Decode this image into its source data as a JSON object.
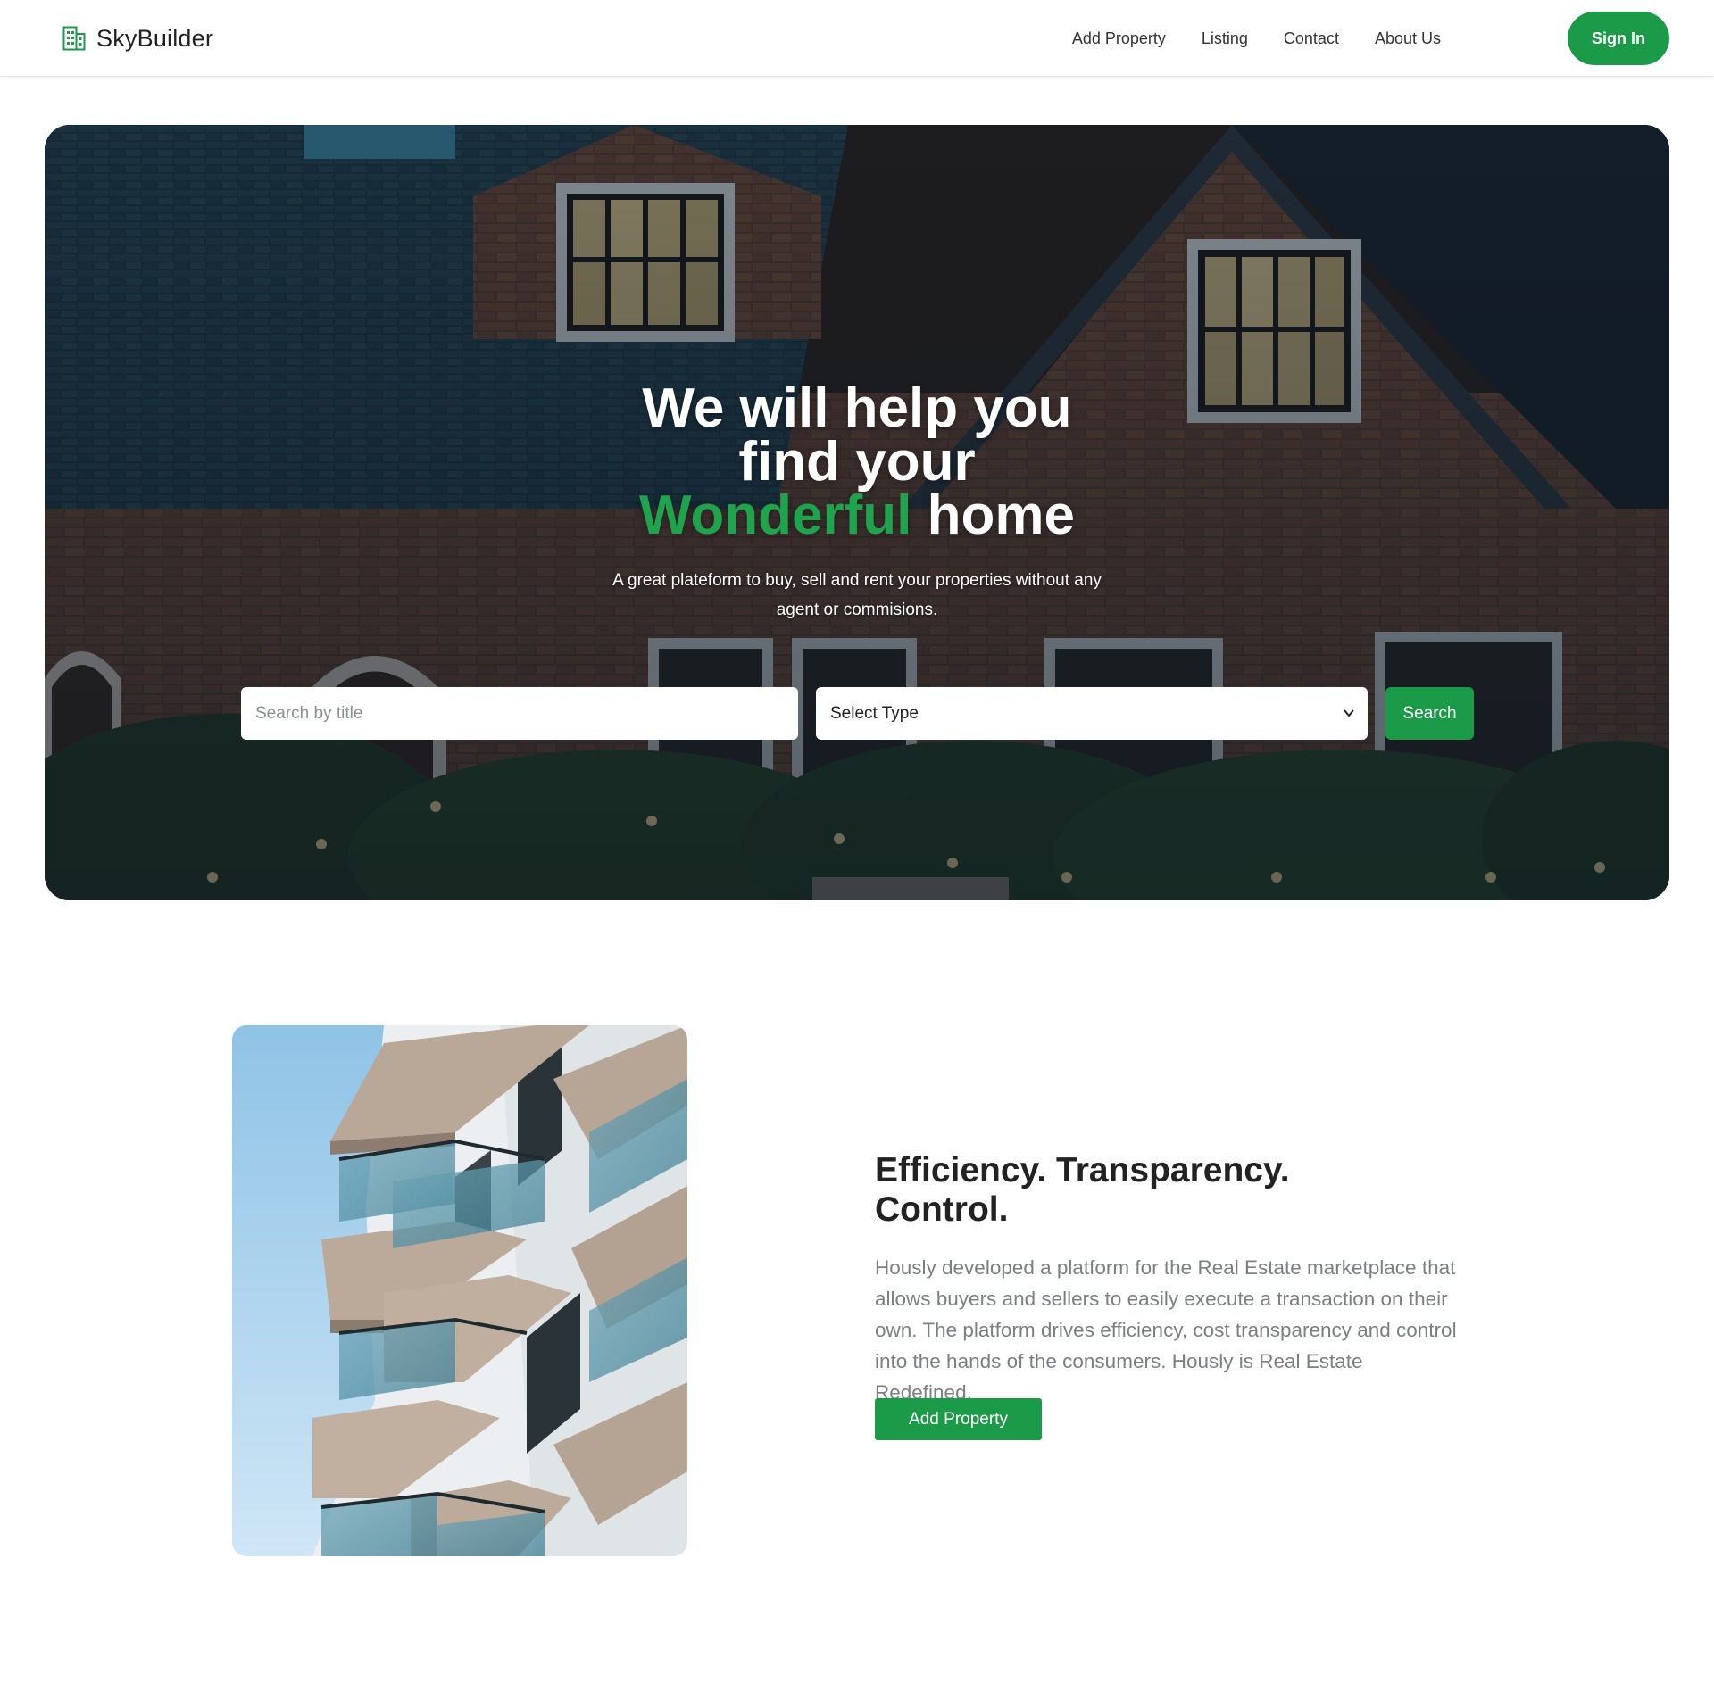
{
  "brand": {
    "name": "SkyBuilder",
    "icon": "building-icon"
  },
  "nav": {
    "links": [
      "Add Property",
      "Listing",
      "Contact",
      "About Us"
    ],
    "signin_label": "Sign In"
  },
  "hero": {
    "title_line1": "We will help you",
    "title_line2": "find your",
    "title_accent": "Wonderful",
    "title_end": "home",
    "subtitle": "A great plateform to buy, sell and rent your properties without any agent or commisions.",
    "search_placeholder": "Search by title",
    "select_value": "Select Type",
    "search_label": "Search"
  },
  "feature": {
    "heading": "Efficiency. Transparency. Control.",
    "text": "Hously developed a platform for the Real Estate marketplace that allows buyers and sellers to easily execute a transaction on their own. The platform drives efficiency, cost transparency and control into the hands of the consumers. Hously is Real Estate Redefined.",
    "button_label": "Add Property"
  },
  "colors": {
    "accent": "#1b9b48",
    "accent_text": "#1fa34d",
    "body_muted": "#7b7f84"
  }
}
